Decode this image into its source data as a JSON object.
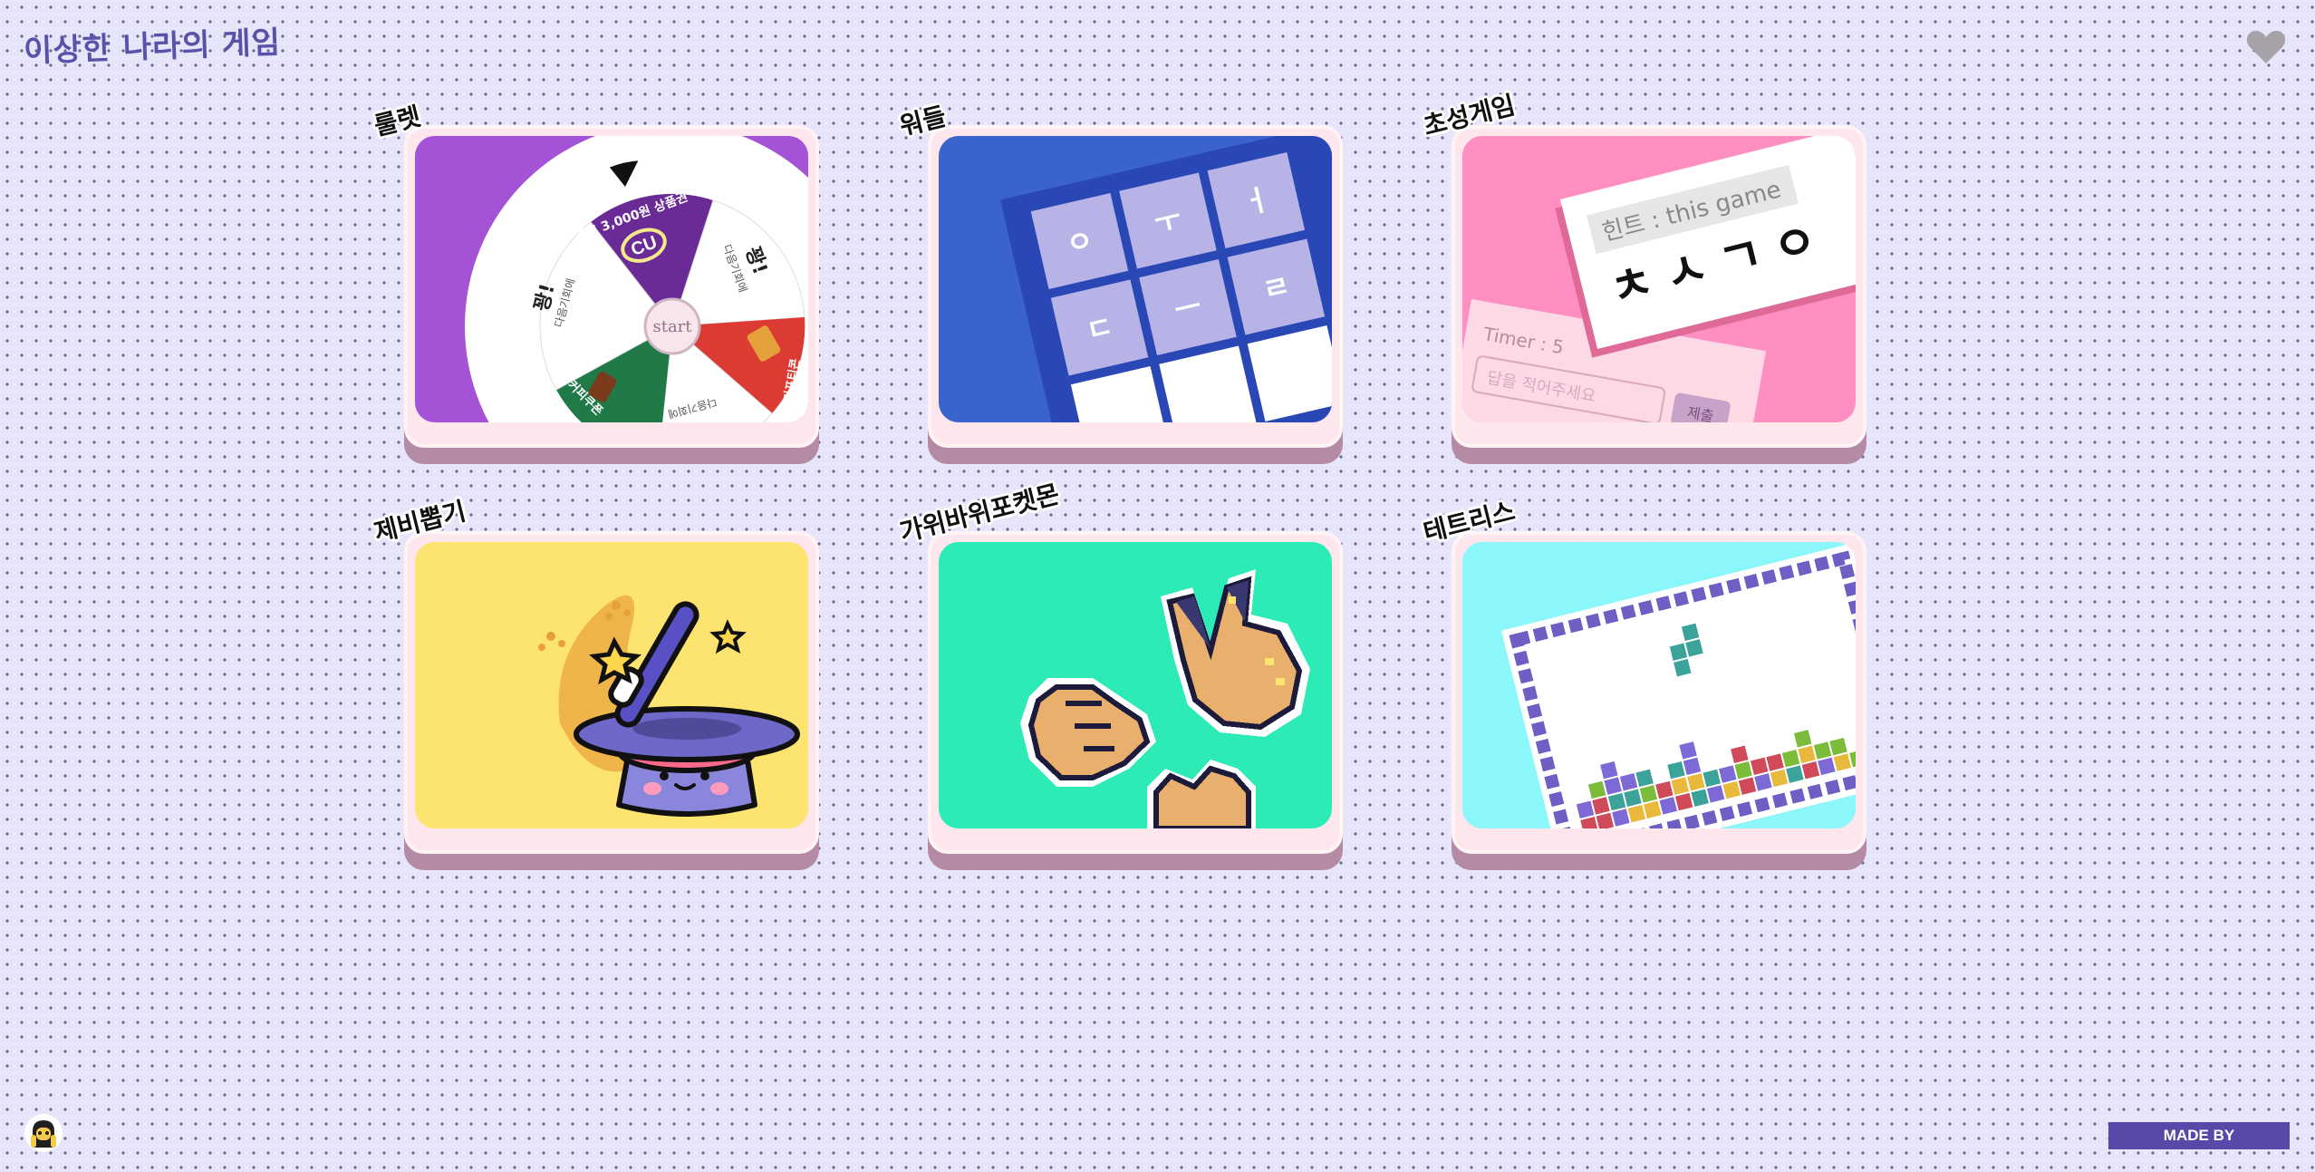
{
  "header": {
    "title": "이상한 나라의 게임"
  },
  "games": [
    {
      "id": "roulette",
      "label": "룰렛",
      "bg": "#a452d6"
    },
    {
      "id": "wordle",
      "label": "워들",
      "bg": "#3a63cc"
    },
    {
      "id": "chosung",
      "label": "초성게임",
      "bg": "#ff8ec2"
    },
    {
      "id": "lottery",
      "label": "제비뽑기",
      "bg": "#fde36f"
    },
    {
      "id": "rps",
      "label": "가위바위포켓몬",
      "bg": "#2debb6"
    },
    {
      "id": "tetris",
      "label": "테트리스",
      "bg": "#8bf7fb"
    }
  ],
  "roulette_art": {
    "center_label": "start",
    "segments": [
      "CU 3,000원 상품권",
      "꽝!",
      "다음기회에",
      "꽝!",
      "다음기회에",
      "다음기회에",
      "커피쿠폰",
      "기프티콘"
    ],
    "logo": "CU"
  },
  "wordle_art": {
    "tiles": [
      "ㅇ",
      "ㅜ",
      "ㅓ",
      "ㄷ",
      "ㅡ",
      "ㄹ"
    ]
  },
  "chosung_art": {
    "hint": "힌트 : this game",
    "letters": "ㅊㅅㄱㅇ",
    "timer": "Timer : 5",
    "placeholder": "답을 적어주세요",
    "submit": "제출"
  },
  "footer": {
    "made_by": "MADE BY"
  },
  "colors": {
    "background": "#e6e5fa",
    "accent": "#5649a8",
    "title": "#5a52a8"
  }
}
